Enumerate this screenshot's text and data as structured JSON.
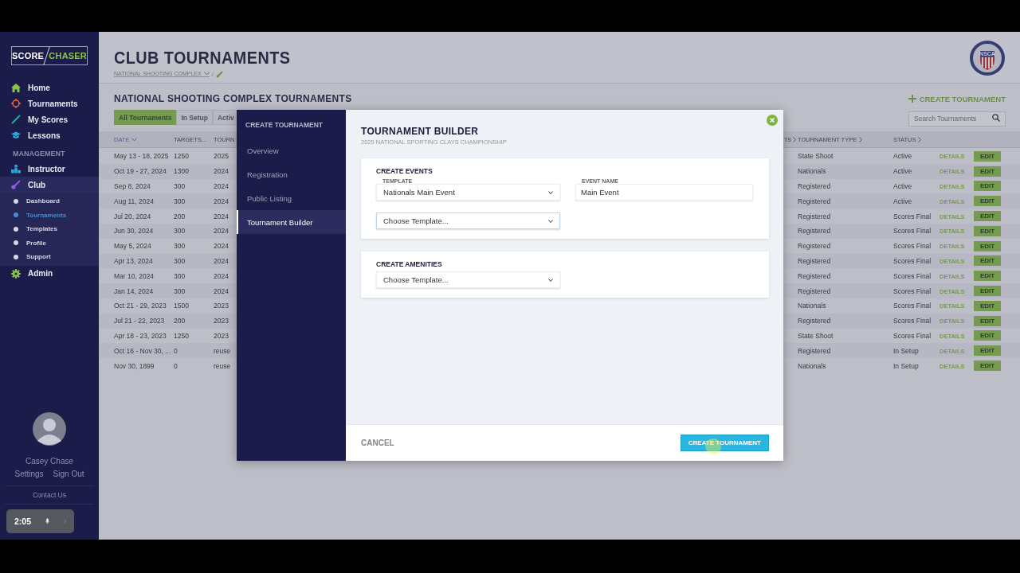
{
  "sidebar": {
    "logo": {
      "left": "SCORE",
      "right": "CHASER"
    },
    "items": [
      {
        "label": "Home",
        "selected": false
      },
      {
        "label": "Tournaments",
        "selected": false
      },
      {
        "label": "My Scores",
        "selected": false
      },
      {
        "label": "Lessons",
        "selected": false
      }
    ],
    "section": "MANAGEMENT",
    "management": [
      {
        "label": "Instructor",
        "selected": false
      },
      {
        "label": "Club",
        "selected": true,
        "children": [
          {
            "label": "Dashboard",
            "selected": false
          },
          {
            "label": "Tournaments",
            "selected": true
          },
          {
            "label": "Templates",
            "selected": false
          },
          {
            "label": "Profile",
            "selected": false
          },
          {
            "label": "Support",
            "selected": false
          }
        ]
      },
      {
        "label": "Admin",
        "selected": false
      }
    ],
    "user": {
      "name": "Casey Chase",
      "links": [
        "Settings",
        "Sign Out"
      ]
    },
    "contact": "Contact Us"
  },
  "header": {
    "title": "CLUB TOURNAMENTS",
    "breadcrumb": "NATIONAL SHOOTING COMPLEX",
    "separator": "/",
    "emblem": "NSCA"
  },
  "section": {
    "title": "NATIONAL SHOOTING COMPLEX TOURNAMENTS",
    "create": "CREATE TOURNAMENT",
    "search": {
      "placeholder": "Search Tournaments"
    },
    "filters": [
      {
        "label": "All Tournaments",
        "selected": true
      },
      {
        "label": "In Setup",
        "selected": false
      },
      {
        "label": "Activ",
        "selected": false
      }
    ]
  },
  "table": {
    "columns": [
      {
        "label": "DATE",
        "sorted": true
      },
      {
        "label": "TARGETS...",
        "sorted": false
      },
      {
        "label": "TOURN",
        "sorted": false
      },
      {
        "label": "TS",
        "sorted": false
      },
      {
        "label": "TOURNAMENT TYPE",
        "sorted": false
      },
      {
        "label": "STATUS",
        "sorted": false
      }
    ],
    "rows": [
      {
        "date": "May 13 - 18, 2025",
        "targets": "1250",
        "column_3": "2025",
        "type": "State Shoot",
        "status": "Active",
        "details": "DETAILS",
        "edit": "EDIT"
      },
      {
        "date": "Oct 19 - 27, 2024",
        "targets": "1300",
        "column_3": "2024",
        "type": "Nationals",
        "status": "Active",
        "details": "DETAILS",
        "edit": "EDIT"
      },
      {
        "date": "Sep 8, 2024",
        "targets": "300",
        "column_3": "2024",
        "type": "Registered",
        "status": "Active",
        "details": "DETAILS",
        "edit": "EDIT"
      },
      {
        "date": "Aug 11, 2024",
        "targets": "300",
        "column_3": "2024",
        "type": "Registered",
        "status": "Active",
        "details": "DETAILS",
        "edit": "EDIT"
      },
      {
        "date": "Jul 20, 2024",
        "targets": "200",
        "column_3": "2024",
        "type": "Registered",
        "status": "Scores Final",
        "details": "DETAILS",
        "edit": "EDIT"
      },
      {
        "date": "Jun 30, 2024",
        "targets": "300",
        "column_3": "2024",
        "type": "Registered",
        "status": "Scores Final",
        "details": "DETAILS",
        "edit": "EDIT"
      },
      {
        "date": "May 5, 2024",
        "targets": "300",
        "column_3": "2024",
        "type": "Registered",
        "status": "Scores Final",
        "details": "DETAILS",
        "edit": "EDIT"
      },
      {
        "date": "Apr 13, 2024",
        "targets": "300",
        "column_3": "2024",
        "type": "Registered",
        "status": "Scores Final",
        "details": "DETAILS",
        "edit": "EDIT"
      },
      {
        "date": "Mar 10, 2024",
        "targets": "300",
        "column_3": "2024",
        "type": "Registered",
        "status": "Scores Final",
        "details": "DETAILS",
        "edit": "EDIT"
      },
      {
        "date": "Jan 14, 2024",
        "targets": "300",
        "column_3": "2024",
        "type": "Registered",
        "status": "Scores Final",
        "details": "DETAILS",
        "edit": "EDIT"
      },
      {
        "date": "Oct 21 - 29, 2023",
        "targets": "1500",
        "column_3": "2023",
        "type": "Nationals",
        "status": "Scores Final",
        "details": "DETAILS",
        "edit": "EDIT"
      },
      {
        "date": "Jul 21 - 22, 2023",
        "targets": "200",
        "column_3": "2023",
        "type": "Registered",
        "status": "Scores Final",
        "details": "DETAILS",
        "edit": "EDIT"
      },
      {
        "date": "Apr 18 - 23, 2023",
        "targets": "1250",
        "column_3": "2023",
        "type": "State Shoot",
        "status": "Scores Final",
        "details": "DETAILS",
        "edit": "EDIT"
      },
      {
        "date": "Oct 16 - Nov 30, ...",
        "targets": "0",
        "column_3": "reuse",
        "type": "Registered",
        "status": "In Setup",
        "details": "DETAILS",
        "edit": "EDIT"
      },
      {
        "date": "Nov 30, 1899",
        "targets": "0",
        "column_3": "reuse",
        "type": "Nationals",
        "status": "In Setup",
        "details": "DETAILS",
        "edit": "EDIT"
      }
    ]
  },
  "modal": {
    "heading": "CREATE TOURNAMENT",
    "steps": [
      {
        "label": "Overview",
        "selected": false
      },
      {
        "label": "Registration",
        "selected": false
      },
      {
        "label": "Public Listing",
        "selected": false
      },
      {
        "label": "Tournament Builder",
        "selected": true
      }
    ],
    "title": "TOURNAMENT BUILDER",
    "subtitle": "2025 NATIONAL SPORTING CLAYS CHAMPIONSHIP",
    "events": {
      "title": "CREATE EVENTS",
      "template_label": "TEMPLATE",
      "template": "Nationals Main Event",
      "name_label": "EVENT NAME",
      "name": "Main Event",
      "next_template": {
        "placeholder": "Choose Template..."
      }
    },
    "amenities": {
      "title": "CREATE AMENITIES",
      "template": {
        "placeholder": "Choose Template..."
      }
    },
    "cancel": "CANCEL",
    "submit": "CREATE TOURNAMENT"
  },
  "recorder": {
    "time": "2:05"
  }
}
